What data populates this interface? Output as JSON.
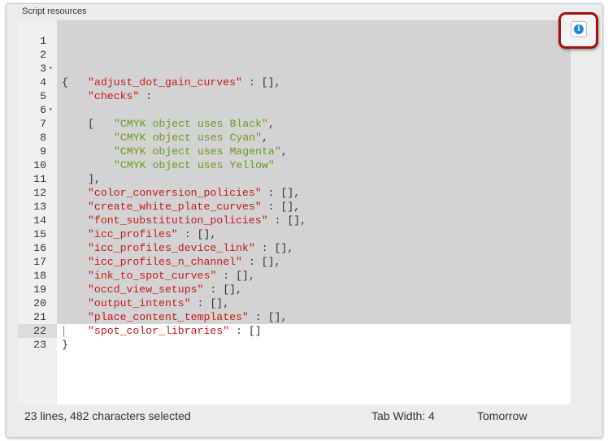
{
  "panel": {
    "title": "Script resources"
  },
  "editor": {
    "lines": [
      {
        "n": "1"
      },
      {
        "n": "2"
      },
      {
        "n": "3"
      },
      {
        "n": "4"
      },
      {
        "n": "5"
      },
      {
        "n": "6"
      },
      {
        "n": "7"
      },
      {
        "n": "8"
      },
      {
        "n": "9"
      },
      {
        "n": "10"
      },
      {
        "n": "11"
      },
      {
        "n": "12"
      },
      {
        "n": "13"
      },
      {
        "n": "14"
      },
      {
        "n": "15"
      },
      {
        "n": "16"
      },
      {
        "n": "17"
      },
      {
        "n": "18"
      },
      {
        "n": "19"
      },
      {
        "n": "20"
      },
      {
        "n": "21"
      },
      {
        "n": "22"
      },
      {
        "n": "23"
      }
    ],
    "fold_marker": "▾",
    "tokens": {
      "open_brace": "{",
      "close_brace": "}",
      "open_bracket": "[",
      "close_bracket_comma": "],",
      "empty_array_comma": " : [],",
      "empty_array": " : []",
      "colon": " :",
      "comma": ",",
      "k_adjust": "\"adjust_dot_gain_curves\"",
      "k_checks": "\"checks\"",
      "v_black": "\"CMYK object uses Black\"",
      "v_cyan": "\"CMYK object uses Cyan\"",
      "v_magenta": "\"CMYK object uses Magenta\"",
      "v_yellow": "\"CMYK object uses Yellow\"",
      "k_color_conv": "\"color_conversion_policies\"",
      "k_white_plate": "\"create_white_plate_curves\"",
      "k_font_sub": "\"font_substitution_policies\"",
      "k_icc": "\"icc_profiles\"",
      "k_icc_dl": "\"icc_profiles_device_link\"",
      "k_icc_n": "\"icc_profiles_n_channel\"",
      "k_ink_spot": "\"ink_to_spot_curves\"",
      "k_occd": "\"occd_view_setups\"",
      "k_output": "\"output_intents\"",
      "k_place": "\"place_content_templates\"",
      "k_spot_lib": "\"spot_color_libraries\""
    }
  },
  "status": {
    "selection_info": "23 lines, 482 characters selected",
    "tab_width": "Tab Width: 4",
    "theme": "Tomorrow"
  },
  "toolbar": {
    "info_icon": "info-icon",
    "info_glyph": "i"
  },
  "colors": {
    "string_key": "#c41a16",
    "string_value": "#6a9a1f",
    "selection": "#d3d3d3",
    "callout_border": "#a31010",
    "info_blue": "#1e88e5"
  }
}
